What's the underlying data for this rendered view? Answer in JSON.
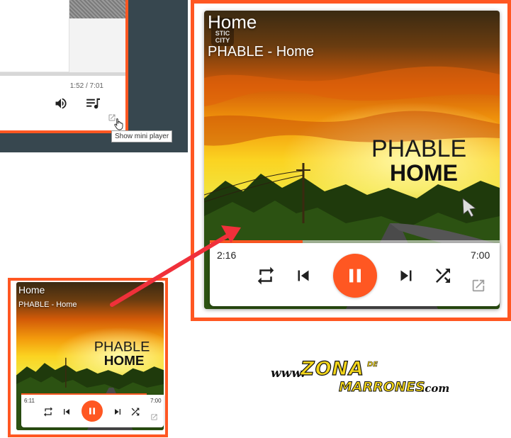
{
  "colors": {
    "accent": "#ff5722",
    "sidebar_bg": "#37474f"
  },
  "top_panel": {
    "time": "1:52 / 7:01",
    "tooltip": "Show mini player",
    "icons": [
      "volume-icon",
      "queue-music-icon",
      "open-in-new-icon",
      "hand-cursor-icon"
    ]
  },
  "big_player": {
    "title": "Home",
    "subtitle": "PHABLE - Home",
    "current_time": "2:16",
    "duration": "7:00",
    "progress": 0.32,
    "album_art": {
      "artist_text": "PHABLE",
      "album_text": "HOME",
      "badge_text": "STIC CITY"
    },
    "icons": [
      "repeat-icon",
      "skip-previous-icon",
      "pause-icon",
      "skip-next-icon",
      "shuffle-icon",
      "open-in-new-icon"
    ]
  },
  "mini_player": {
    "title": "Home",
    "subtitle": "PHABLE - Home",
    "current_time": "6:11",
    "duration": "7:00",
    "progress": 0.88,
    "album_art": {
      "artist_text": "PHABLE",
      "album_text": "HOME"
    }
  },
  "watermark": {
    "www": "www.",
    "zona": "ZONA",
    "de": "DE",
    "marrones": "MARRONES",
    "com": ".com"
  }
}
